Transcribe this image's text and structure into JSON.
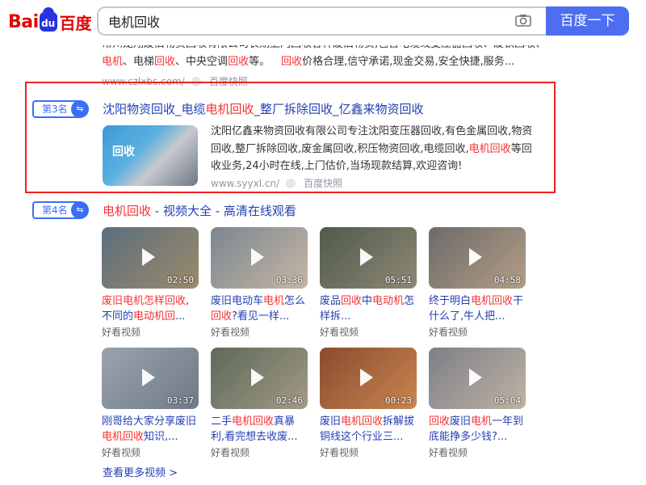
{
  "header": {
    "logo_text_left": "Bai",
    "logo_text_paw": "du",
    "logo_text_cn": "百度",
    "search_value": "电机回收",
    "search_button": "百度一下",
    "camera_icon": "camera-icon"
  },
  "prev_result": {
    "line1": "常州龙翔废旧物资回收有限公司长期上门回收各种废旧物资,包含电缆线变压器回收、废铁回收、",
    "line2_a": "电机",
    "line2_b": "、电梯",
    "line2_c": "回收",
    "line2_d": "、中央空调",
    "line2_e": "回收",
    "line2_f": "等。",
    "line2_g": "回收",
    "line2_h": "价格合理,信守承诺,现金交易,安全快捷,服务...",
    "url": "www.czlxbs.com/",
    "snapshot": "百度快照"
  },
  "result3": {
    "rank": "第3名",
    "title_a": "沈阳物资回收_电缆",
    "title_b": "电机回收",
    "title_c": "_整厂拆除回收_亿鑫来物资回收",
    "image_word": "回收",
    "desc_a": "沈阳亿鑫来物资回收有限公司专注沈阳变压器回收,有色金属回收,物资回收,整厂拆除回收,废金属回收,积压物资回收,电缆回收,",
    "desc_b": "电机回收",
    "desc_c": "等回收业务,24小时在线,上门估价,当场现款结算,欢迎咨询!",
    "url": "www.syyxl.cn/",
    "snapshot": "百度快照"
  },
  "result4": {
    "rank": "第4名",
    "title_a": "电机回收",
    "title_b": " - 视频大全 - 高清在线观看",
    "more": "查看更多视频 >",
    "videos": [
      {
        "duration": "02:50",
        "t": [
          [
            "废旧电机怎样",
            1
          ],
          [
            "回收",
            1
          ],
          [
            ",不同的",
            0
          ],
          [
            "电动机",
            1
          ],
          [
            "回",
            1
          ],
          [
            "...",
            0
          ]
        ],
        "source": "好看视频",
        "c1": "#5b6e7d",
        "c2": "#9c8a6a"
      },
      {
        "duration": "03:36",
        "t": [
          [
            "废旧电动车",
            0
          ],
          [
            "电机",
            1
          ],
          [
            "怎么",
            0
          ],
          [
            "回收",
            1
          ],
          [
            "?看见一样...",
            0
          ]
        ],
        "source": "好看视频",
        "c1": "#7a8793",
        "c2": "#c6b6a2"
      },
      {
        "duration": "05:51",
        "t": [
          [
            "废品",
            0
          ],
          [
            "回收",
            1
          ],
          [
            "中",
            0
          ],
          [
            "电动机",
            1
          ],
          [
            "怎样拆...",
            0
          ]
        ],
        "source": "好看视频",
        "c1": "#4f5b4c",
        "c2": "#8f8875"
      },
      {
        "duration": "04:58",
        "t": [
          [
            "终于明白",
            0
          ],
          [
            "电机回收",
            1
          ],
          [
            "干什么了,牛人把...",
            0
          ]
        ],
        "source": "好看视频",
        "c1": "#6d6a6a",
        "c2": "#b39e86"
      },
      {
        "duration": "03:37",
        "t": [
          [
            "刚哥给大家分享废旧",
            0
          ],
          [
            "电机回收",
            1
          ],
          [
            "知识,...",
            0
          ]
        ],
        "source": "好看视频",
        "c1": "#9aa3ad",
        "c2": "#6e7a86"
      },
      {
        "duration": "02:46",
        "t": [
          [
            "二手",
            0
          ],
          [
            "电机回收",
            1
          ],
          [
            "真暴利,看完想去收废...",
            0
          ]
        ],
        "source": "好看视频",
        "c1": "#5d6a59",
        "c2": "#a39a86"
      },
      {
        "duration": "00:23",
        "t": [
          [
            "废旧",
            0
          ],
          [
            "电机回收",
            1
          ],
          [
            "拆解拔铜线这个行业三...",
            0
          ]
        ],
        "source": "好看视频",
        "c1": "#8a4b2c",
        "c2": "#c98652"
      },
      {
        "duration": "05:04",
        "t": [
          [
            "回收",
            1
          ],
          [
            "废旧",
            0
          ],
          [
            "电机",
            1
          ],
          [
            "一年到底能挣多少钱?...",
            0
          ]
        ],
        "source": "好看视频",
        "c1": "#7d7f88",
        "c2": "#bfb3a3"
      }
    ]
  }
}
